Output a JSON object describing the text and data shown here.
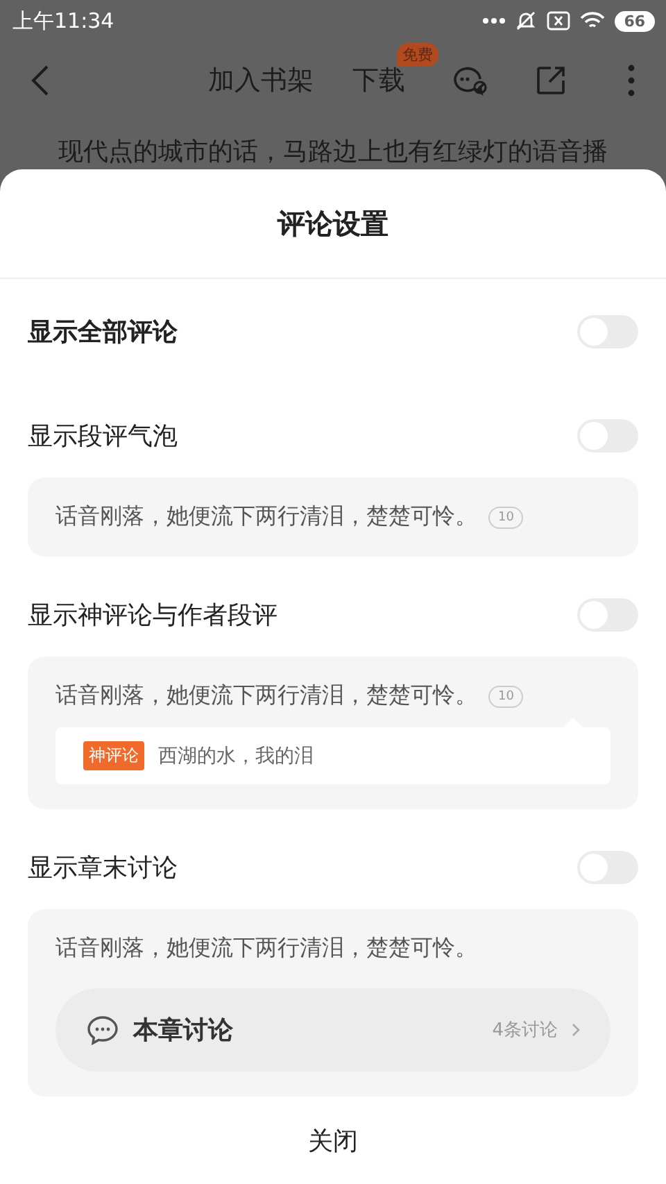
{
  "status_bar": {
    "time": "上午11:34",
    "battery": "66"
  },
  "nav": {
    "add_shelf": "加入书架",
    "download": "下载",
    "download_badge": "免费"
  },
  "reading_text": "现代点的城市的话，马路边上也有红绿灯的语音播",
  "sheet": {
    "title": "评论设置",
    "settings": [
      {
        "kind": "master",
        "label": "显示全部评论",
        "on": false
      },
      {
        "kind": "bubble",
        "label": "显示段评气泡",
        "on": false,
        "preview": {
          "text": "话音刚落，她便流下两行清泪，楚楚可怜。",
          "count": "10"
        }
      },
      {
        "kind": "god_comment",
        "label": "显示神评论与作者段评",
        "on": false,
        "preview": {
          "text": "话音刚落，她便流下两行清泪，楚楚可怜。",
          "count": "10",
          "tag": "神评论",
          "comment": "西湖的水，我的泪"
        }
      },
      {
        "kind": "chapter_end",
        "label": "显示章末讨论",
        "on": false,
        "preview": {
          "text": "话音刚落，她便流下两行清泪，楚楚可怜。",
          "discussion_title": "本章讨论",
          "discussion_count": "4条讨论"
        }
      }
    ],
    "close": "关闭"
  }
}
